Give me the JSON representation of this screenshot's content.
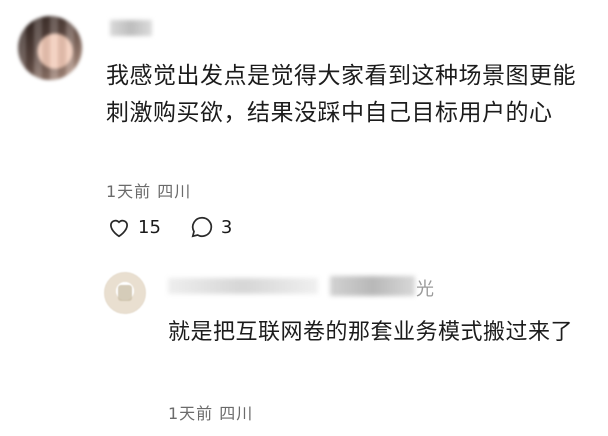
{
  "comment": {
    "text": "我感觉出发点是觉得大家看到这种场景图更能刺激购买欲，结果没踩中自己目标用户的心",
    "time": "1天前",
    "location": "四川",
    "likes": "15",
    "replies": "3"
  },
  "reply": {
    "author_visible_tail": "光",
    "text": "就是把互联网卷的那套业务模式搬过来了",
    "time": "1天前",
    "location": "四川"
  }
}
